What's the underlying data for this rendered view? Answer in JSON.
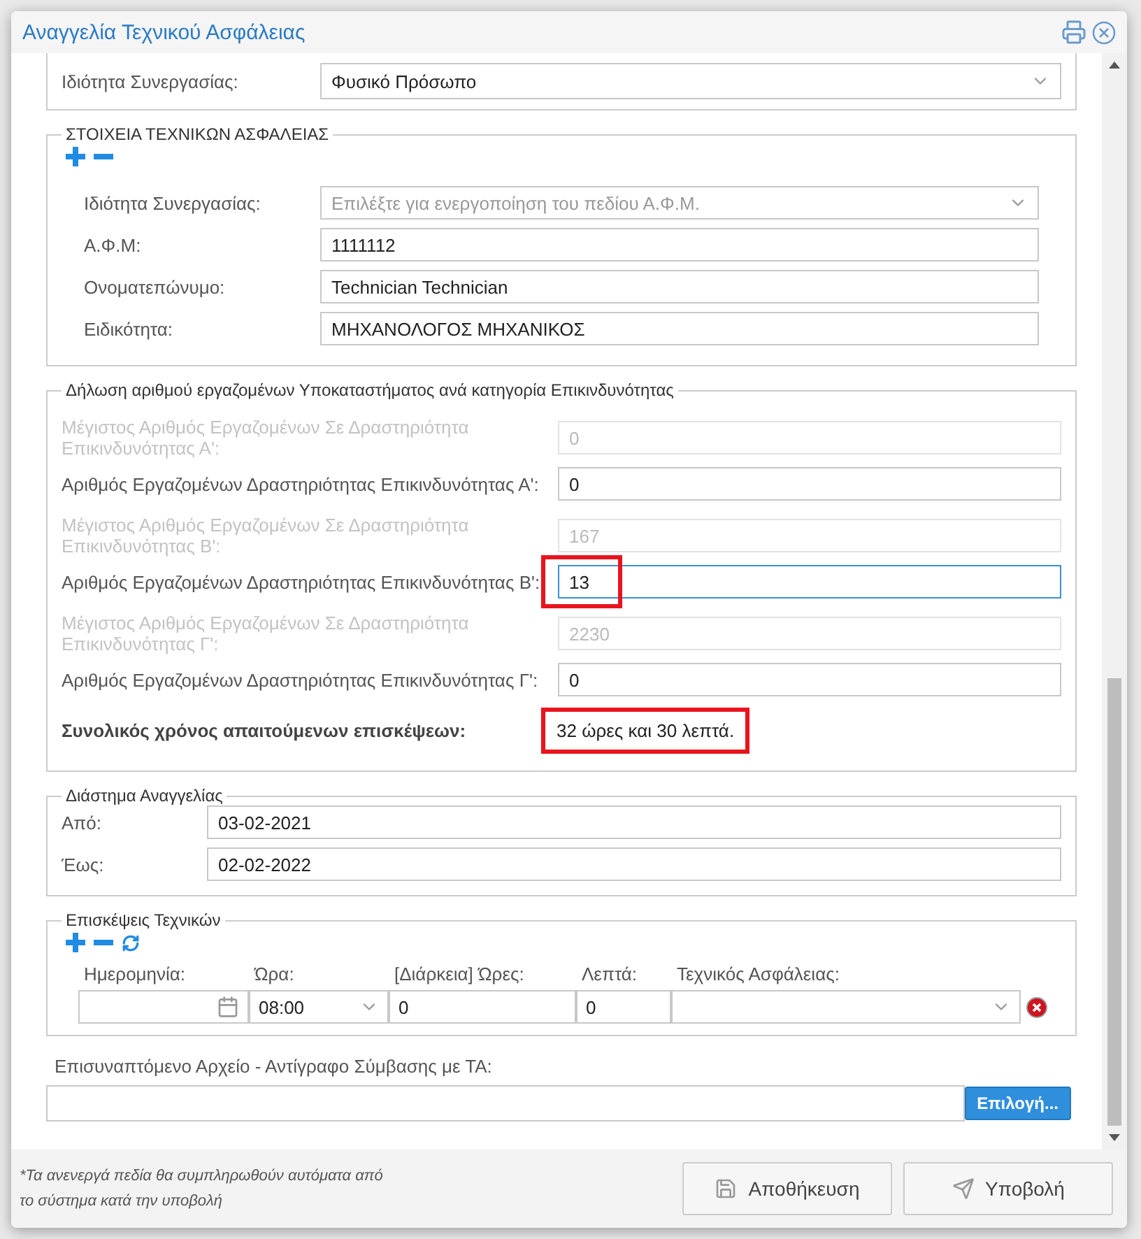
{
  "dialog": {
    "title": "Αναγγελία Τεχνικού Ασφάλειας"
  },
  "partnership": {
    "label": "Ιδιότητα Συνεργασίας:",
    "value": "Φυσικό Πρόσωπο"
  },
  "technicians": {
    "legend": "ΣΤΟΙΧΕΙΑ ΤΕΧΝΙΚΩΝ ΑΣΦΑΛΕΙΑΣ",
    "fields": [
      {
        "kind": "select",
        "label": "Ιδιότητα Συνεργασίας:",
        "placeholder": "Επιλέξτε για ενεργοποίηση του πεδίου Α.Φ.Μ.",
        "disabled": true
      },
      {
        "kind": "text",
        "label": "Α.Φ.Μ:",
        "value": "1111112",
        "disabled": false
      },
      {
        "kind": "text",
        "label": "Ονοματεπώνυμο:",
        "value": "Technician Technician",
        "disabled": false
      },
      {
        "kind": "text",
        "label": "Ειδικότητα:",
        "value": "ΜΗΧΑΝΟΛΟΓΟΣ ΜΗΧΑΝΙΚΟΣ",
        "disabled": false
      }
    ]
  },
  "employees": {
    "legend": "Δήλωση αριθμού εργαζομένων Υποκαταστήματος ανά κατηγορία Επικινδυνότητας",
    "rows": [
      {
        "label": "Μέγιστος Αριθμός Εργαζομένων Σε Δραστηριότητα Επικινδυνότητας Α':",
        "value": "0",
        "disabled": true,
        "focused": false,
        "highlighted": false
      },
      {
        "label": "Αριθμός Εργαζομένων Δραστηριότητας Επικινδυνότητας Α':",
        "value": "0",
        "disabled": false,
        "focused": false,
        "highlighted": false
      },
      {
        "label": "Μέγιστος Αριθμός Εργαζομένων Σε Δραστηριότητα Επικινδυνότητας Β':",
        "value": "167",
        "disabled": true,
        "focused": false,
        "highlighted": false
      },
      {
        "label": "Αριθμός Εργαζομένων Δραστηριότητας Επικινδυνότητας Β':",
        "value": "13",
        "disabled": false,
        "focused": true,
        "highlighted": true
      },
      {
        "label": "Μέγιστος Αριθμός Εργαζομένων Σε Δραστηριότητα Επικινδυνότητας Γ':",
        "value": "2230",
        "disabled": true,
        "focused": false,
        "highlighted": false
      },
      {
        "label": "Αριθμός Εργαζομένων Δραστηριότητας Επικινδυνότητας Γ':",
        "value": "0",
        "disabled": false,
        "focused": false,
        "highlighted": false
      }
    ],
    "total": {
      "label": "Συνολικός χρόνος απαιτούμενων επισκέψεων:",
      "value": "32 ώρες και 30 λεπτά.",
      "highlighted": true
    }
  },
  "period": {
    "legend": "Διάστημα Αναγγελίας",
    "fields": [
      {
        "label": "Από:",
        "value": "03-02-2021"
      },
      {
        "label": "Έως:",
        "value": "02-02-2022"
      }
    ]
  },
  "visits": {
    "legend": "Επισκέψεις Τεχνικών",
    "columns": [
      "Ημερομηνία:",
      "Ώρα:",
      "[Διάρκεια] Ώρες:",
      "Λεπτά:",
      "Τεχνικός Ασφάλειας:"
    ],
    "row": {
      "time": "08:00",
      "hours": "0",
      "minutes": "0"
    }
  },
  "attachment": {
    "label": "Επισυναπτόμενο Αρχείο - Αντίγραφο Σύμβασης με ΤΑ:",
    "button": "Επιλογή..."
  },
  "footer": {
    "note": "*Τα ανενεργά πεδία θα συμπληρωθούν αυτόματα από το σύστημα κατά την υποβολή",
    "buttons": [
      {
        "kind": "save",
        "label": "Αποθήκευση"
      },
      {
        "kind": "submit",
        "label": "Υποβολή"
      }
    ]
  }
}
